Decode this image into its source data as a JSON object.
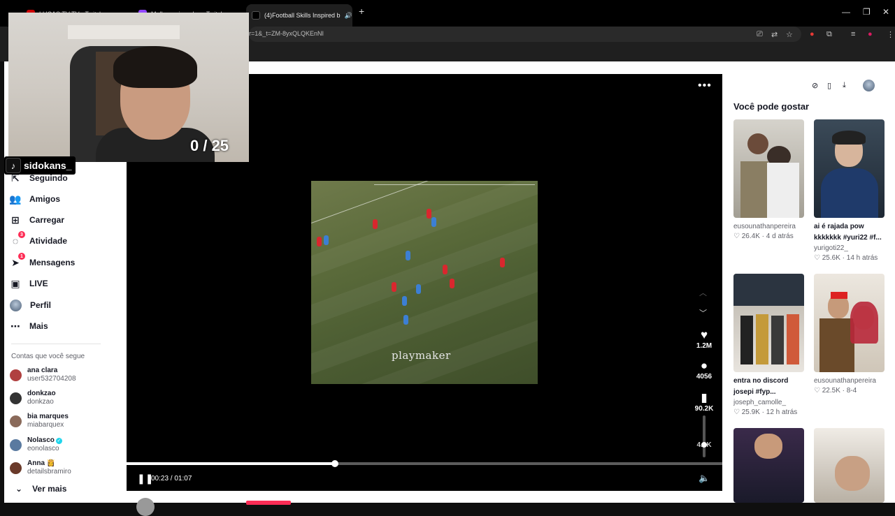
{
  "browser": {
    "tabs": [
      {
        "label": "LUCAS TV TV - Twitch"
      },
      {
        "label": "Melhores jogadas - Twitch"
      },
      {
        "label": "(4)Football Skills Inspired b"
      }
    ],
    "url_visible": "r=1&_t=ZM-8yxQLQKEnNI",
    "new_tab": "+",
    "close_tab": "✕"
  },
  "sidebar": {
    "items": [
      {
        "label": "Seguindo",
        "icon": "following-icon"
      },
      {
        "label": "Amigos",
        "icon": "friends-icon"
      },
      {
        "label": "Carregar",
        "icon": "upload-icon"
      },
      {
        "label": "Atividade",
        "icon": "activity-icon",
        "badge": "3"
      },
      {
        "label": "Mensagens",
        "icon": "messages-icon",
        "badge": "1"
      },
      {
        "label": "LIVE",
        "icon": "live-icon"
      },
      {
        "label": "Perfil",
        "icon": "profile-avatar"
      },
      {
        "label": "Mais",
        "icon": "more-icon"
      }
    ],
    "following_title": "Contas que você segue",
    "accounts": [
      {
        "name": "ana clara",
        "user": "user532704208",
        "color": "#b04040"
      },
      {
        "name": "donkzao",
        "user": "donkzao",
        "color": "#333333"
      },
      {
        "name": "bia marques",
        "user": "miabarquex",
        "color": "#8a6a5a"
      },
      {
        "name": "Nolasco",
        "user": "eonolasco",
        "color": "#5a7aa0",
        "verified": true
      },
      {
        "name": "Anna",
        "user": "detailsbramiro",
        "color": "#6a3a2a",
        "emoji": "👸"
      }
    ],
    "see_more": "Ver mais"
  },
  "player": {
    "watermark": "playmaker",
    "likes": "1.2M",
    "comments": "4056",
    "saves": "90.2K",
    "shares": "4...K",
    "time_current": "00:23",
    "time_total": "01:07",
    "time_sep": " / ",
    "progress": 0.35,
    "volume": 0.3
  },
  "recommend": {
    "title": "Você pode gostar",
    "cards": [
      {
        "caption": "",
        "user": "eusounathanpereira",
        "likes": "26.4K",
        "age": "4 d atrás"
      },
      {
        "caption": "ai é rajada pow kkkkkkk #yuri22 #f...",
        "user": "yurigoti22_",
        "likes": "25.6K",
        "age": "14 h atrás"
      },
      {
        "caption": "entra no discord josepi #fyp...",
        "user": "joseph_camolle_",
        "likes": "25.9K",
        "age": "12 h atrás"
      },
      {
        "caption": "",
        "user": "eusounathanpereira",
        "likes": "22.5K",
        "age": "8-4"
      }
    ]
  },
  "stream_overlay": {
    "counter": "0 / 25",
    "channel": "sidokans_"
  }
}
